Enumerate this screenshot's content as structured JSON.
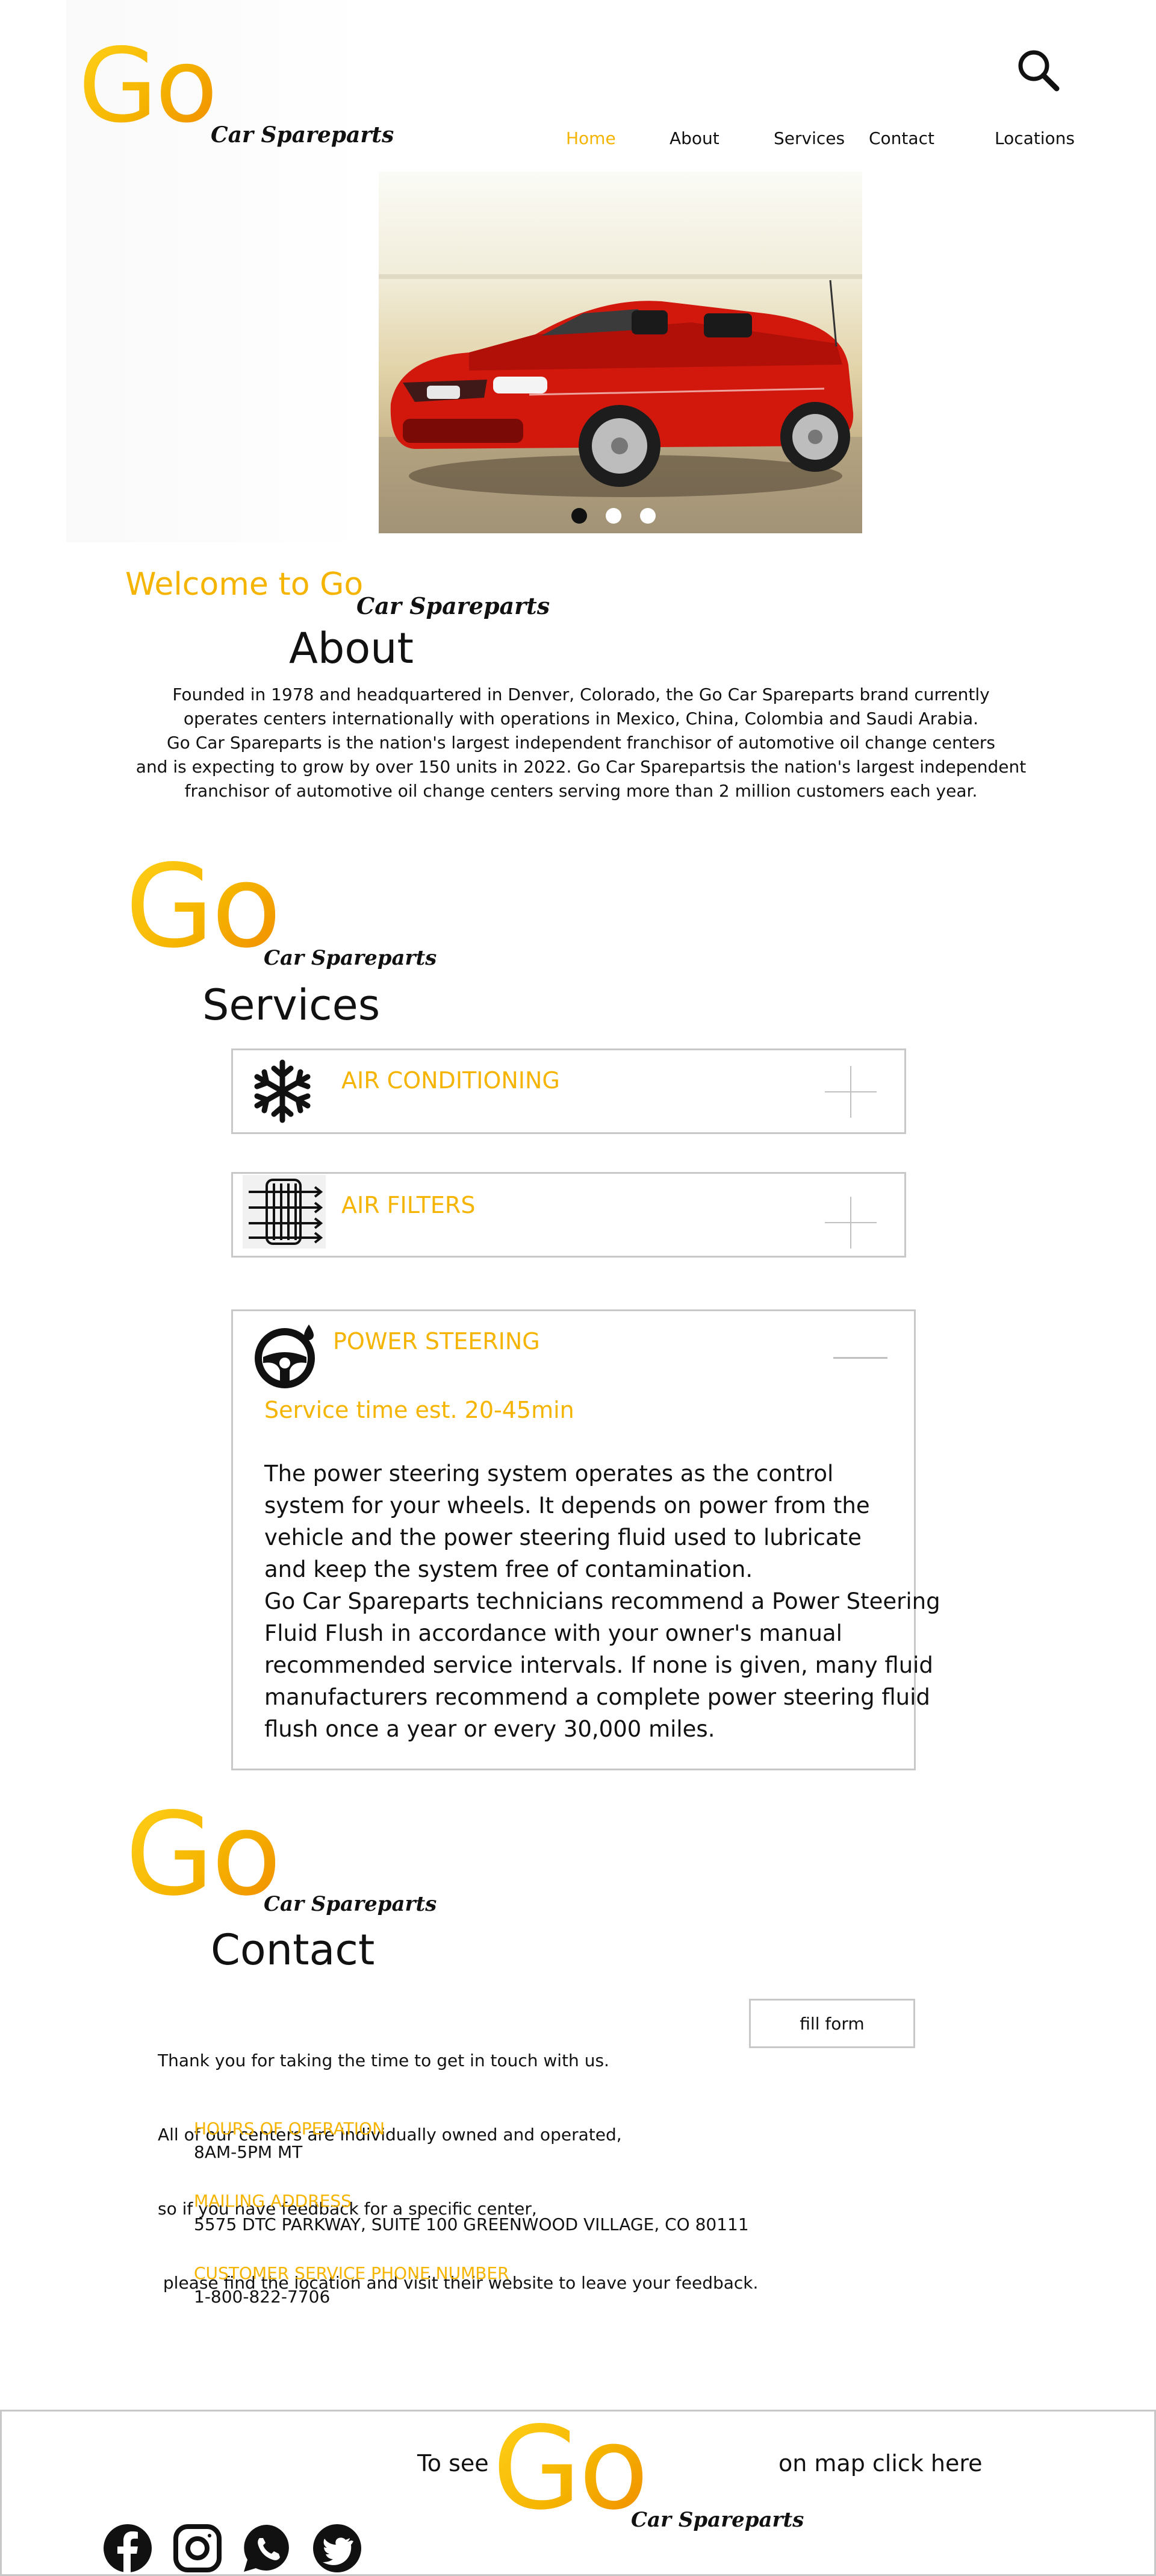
{
  "brand": {
    "logo_go": "Go",
    "tagline": "Car Spareparts"
  },
  "header": {
    "nav": [
      "Home",
      "About",
      "Services",
      "Contact",
      "Locations"
    ],
    "active": "Home"
  },
  "hero": {
    "image_alt": "red convertible car",
    "slides": 3,
    "active_slide": 1
  },
  "welcome": {
    "prefix": "Welcome to Go",
    "tagline": "Car Spareparts"
  },
  "about": {
    "heading": "About",
    "lines": [
      "Founded in 1978 and headquartered in Denver, Colorado, the Go Car Spareparts brand currently",
      "operates centers internationally with operations in Mexico, China, Colombia and Saudi Arabia.",
      "Go Car Spareparts is the nation's largest independent franchisor of automotive oil change centers",
      "and is expecting to grow by over 150 units in 2022. Go Car Sparepartsis the nation's largest independent",
      "franchisor of automotive oil change centers serving more than 2 million customers each year."
    ]
  },
  "services": {
    "heading": "Services",
    "items": [
      {
        "title": "AIR CONDITIONING",
        "icon": "snowflake-icon",
        "expanded": false
      },
      {
        "title": "AIR FILTERS",
        "icon": "air-filter-icon",
        "expanded": false
      },
      {
        "title": "POWER STEERING",
        "icon": "steering-wheel-icon",
        "expanded": true,
        "time": "Service time est. 20-45min",
        "lines": [
          "The power steering system operates as the control",
          "system for your wheels. It depends on power from the",
          "vehicle and the power steering fluid used to lubricate",
          "and keep the system free of contamination.",
          "Go Car Spareparts technicians recommend a Power Steering",
          "Fluid Flush in accordance with your owner's manual",
          "recommended service intervals. If none is given, many fluid",
          "manufacturers recommend a complete power steering fluid",
          "flush once a year or every 30,000 miles."
        ]
      }
    ]
  },
  "contact": {
    "heading": "Contact",
    "intro": [
      "Thank you for taking the time to get in touch with us.",
      "All of our centers are individually owned and operated,",
      "so if you have feedback for a specific center,",
      " please find the location and visit their website to leave your feedback."
    ],
    "form_button": "fill form",
    "hours_label": "HOURS OF OPERATION",
    "hours_value": "8AM-5PM MT",
    "mail_label": "MAILING ADDRESS",
    "mail_value": "5575 DTC PARKWAY, SUITE 100 GREENWOOD VILLAGE, CO 80111",
    "phone_label": "CUSTOMER SERVICE PHONE NUMBER",
    "phone_value": "1-800-822-7706"
  },
  "footer": {
    "prefix": "To see",
    "suffix": "on map click here",
    "social": [
      "facebook-icon",
      "instagram-icon",
      "whatsapp-icon",
      "twitter-icon"
    ]
  },
  "colors": {
    "accent": "#f5b400",
    "accent_dark": "#f08a00",
    "border": "#c8c8c8",
    "text": "#111111"
  }
}
